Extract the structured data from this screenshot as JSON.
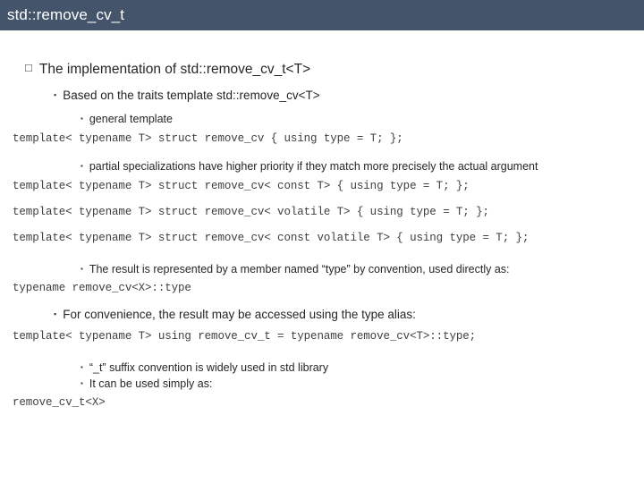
{
  "title": "std::remove_cv_t",
  "bullets": {
    "b1": "The implementation of std::remove_cv_t<T>",
    "b2": "Based on the traits template std::remove_cv<T>",
    "b3": "general template",
    "b4": "partial specializations have higher priority if they match more precisely the actual argument",
    "b5": "The result is represented by a member named “type” by convention, used directly as:",
    "b6": "For convenience, the result may be accessed using the type alias:",
    "b7": "“_t” suffix convention is widely used in std library",
    "b8": "It can be used simply as:"
  },
  "code": {
    "c1": "template< typename T> struct remove_cv { using type = T; };",
    "c2": "template< typename T> struct remove_cv< const T> { using type = T; };",
    "c3": "template< typename T> struct remove_cv< volatile T> { using type = T; };",
    "c4": "template< typename T> struct remove_cv< const volatile T> { using type = T; };",
    "c5": "typename remove_cv<X>::type",
    "c6": "template< typename T> using remove_cv_t = typename remove_cv<T>::type;",
    "c7": "remove_cv_t<X>"
  },
  "glyphs": {
    "lvl1_bullet": "□",
    "lvl2_bullet": "▪",
    "lvl3_bullet": "▪"
  },
  "colors": {
    "title_bar": "#44546a",
    "title_text": "#ffffff",
    "body_text": "#262626",
    "code_text": "#3f3f3f"
  }
}
